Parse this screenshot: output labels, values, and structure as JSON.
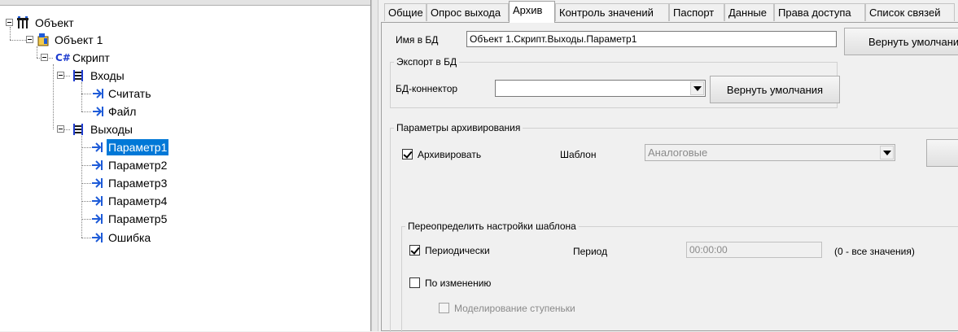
{
  "tree": {
    "root": "Объект",
    "object1": "Объект 1",
    "script": "Скрипт",
    "script_prefix": "C#",
    "inputs": "Входы",
    "input_items": [
      "Считать",
      "Файл"
    ],
    "outputs": "Выходы",
    "output_items": [
      "Параметр1",
      "Параметр2",
      "Параметр3",
      "Параметр4",
      "Параметр5",
      "Ошибка"
    ],
    "selected": "Параметр1"
  },
  "tabs": [
    "Общие",
    "Опрос выхода",
    "Архив",
    "Контроль значений",
    "Паспорт",
    "Данные",
    "Права доступа",
    "Список связей"
  ],
  "active_tab": "Архив",
  "archive": {
    "db_name_label": "Имя в БД",
    "db_name_value": "Объект 1.Скрипт.Выходы.Параметр1",
    "reset_top_label": "Вернуть умолчани",
    "export_group": "Экспорт в БД",
    "connector_label": "БД-коннектор",
    "connector_value": "",
    "reset_connector_label": "Вернуть умолчания",
    "params_group": "Параметры архивирования",
    "archive_checkbox_label": "Архивировать",
    "archive_checked": true,
    "template_label": "Шаблон",
    "template_value": "Аналоговые",
    "override_group": "Переопределить настройки шаблона",
    "periodic_label": "Периодически",
    "periodic_checked": true,
    "period_label": "Период",
    "period_value": "00:00:00",
    "period_hint": "(0 - все значения)",
    "on_change_label": "По изменению",
    "on_change_checked": false,
    "step_label": "Моделирование ступеньки",
    "step_checked": false
  },
  "colors": {
    "selection": "#0078d7",
    "icon_blue": "#1e5bd8"
  }
}
